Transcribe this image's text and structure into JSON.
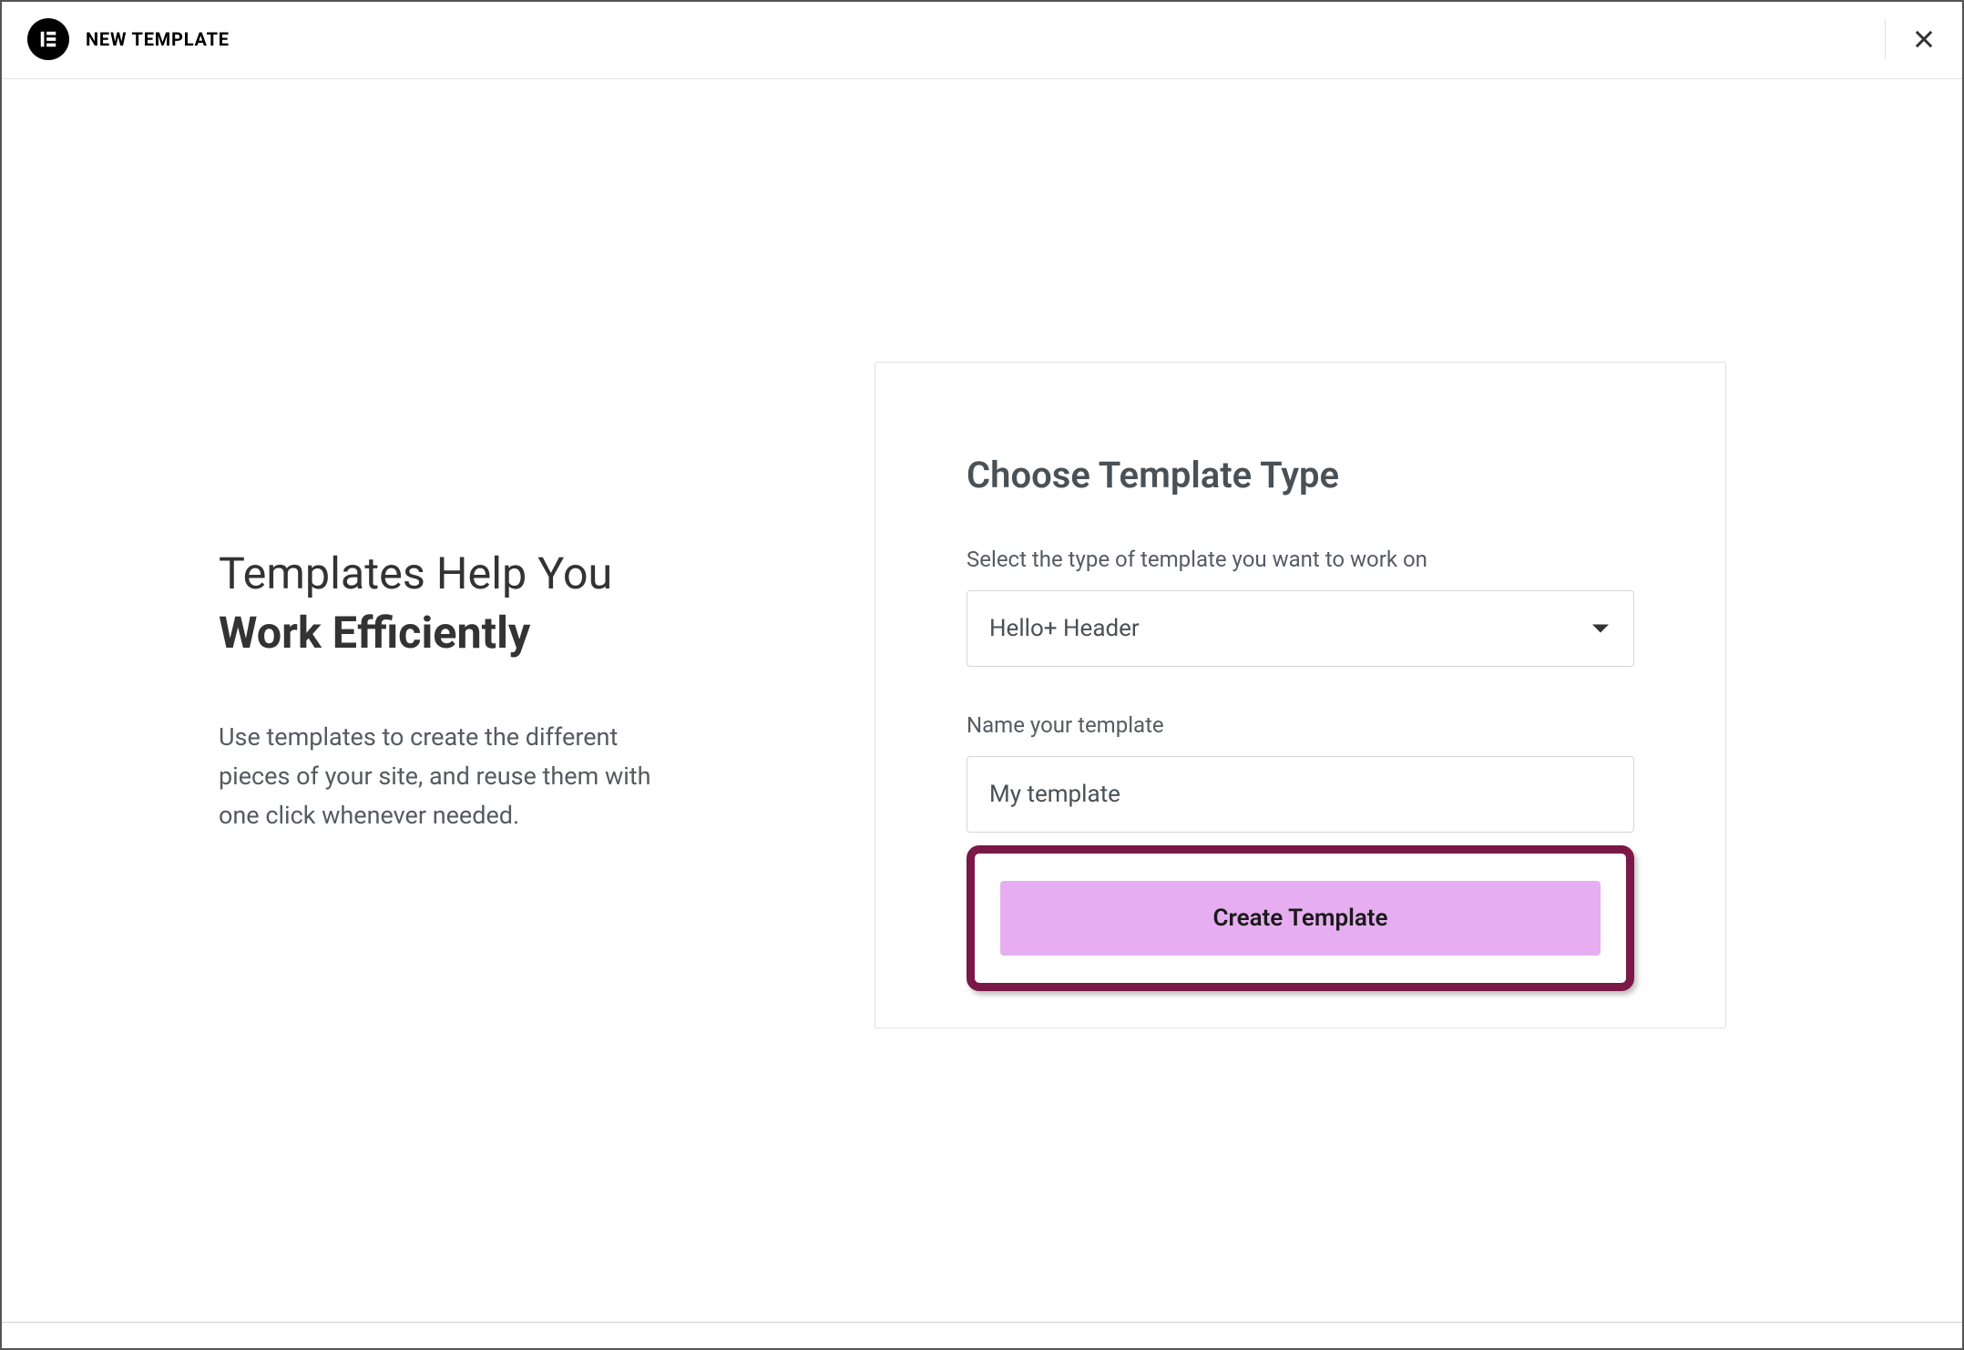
{
  "header": {
    "title": "NEW TEMPLATE"
  },
  "left": {
    "title_line1": "Templates Help You",
    "title_line2": "Work Efficiently",
    "description": "Use templates to create the different pieces of your site, and reuse them with one click whenever needed."
  },
  "form": {
    "title": "Choose Template Type",
    "type_label": "Select the type of template you want to work on",
    "type_value": "Hello+ Header",
    "name_label": "Name your template",
    "name_value": "My template",
    "submit_label": "Create Template"
  }
}
